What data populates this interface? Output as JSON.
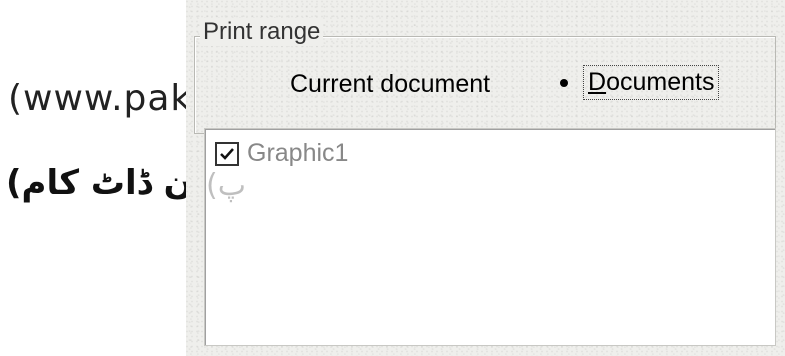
{
  "background": {
    "url_text": "(www.paks",
    "urdu_text": "(پاکستان ڈاٹ کام)",
    "urdu_remnant": "(پ"
  },
  "dialog": {
    "group_title": "Print range",
    "radio_current_label": "Current document",
    "radio_documents_label_first": "D",
    "radio_documents_label_rest": "ocuments",
    "selected_option": "Documents",
    "list": {
      "items": [
        {
          "label": "Graphic1",
          "checked": true
        }
      ]
    }
  },
  "colors": {
    "dialog_bg": "#efefec",
    "list_bg": "#ffffff",
    "disabled_text": "#888888"
  }
}
